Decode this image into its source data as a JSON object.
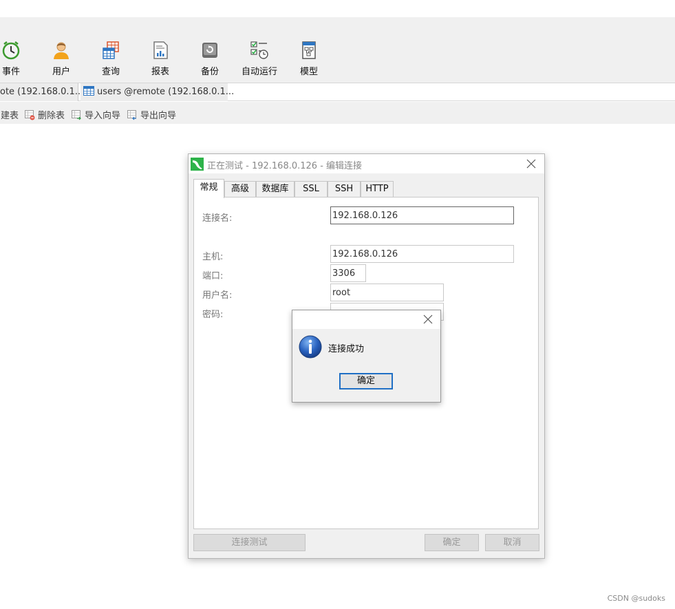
{
  "toolbar": {
    "items": [
      {
        "label": "事件",
        "icon": "clock-icon"
      },
      {
        "label": "用户",
        "icon": "user-icon"
      },
      {
        "label": "查询",
        "icon": "query-table-icon"
      },
      {
        "label": "报表",
        "icon": "report-icon"
      },
      {
        "label": "备份",
        "icon": "backup-icon"
      },
      {
        "label": "自动运行",
        "icon": "schedule-icon"
      },
      {
        "label": "模型",
        "icon": "model-icon"
      }
    ]
  },
  "tabs": {
    "items": [
      {
        "label": "ote (192.168.0.1..."
      },
      {
        "label": "users @remote (192.168.0.1..."
      }
    ]
  },
  "subtoolbar": {
    "items": [
      {
        "label": "建表"
      },
      {
        "label": "删除表"
      },
      {
        "label": "导入向导"
      },
      {
        "label": "导出向导"
      }
    ]
  },
  "connection_dialog": {
    "title": "正在测试 - 192.168.0.126 - 编辑连接",
    "tabs": [
      "常规",
      "高级",
      "数据库",
      "SSL",
      "SSH",
      "HTTP"
    ],
    "active_tab": "常规",
    "fields": {
      "connection_name": {
        "label": "连接名:",
        "value": "192.168.0.126"
      },
      "host": {
        "label": "主机:",
        "value": "192.168.0.126"
      },
      "port": {
        "label": "端口:",
        "value": "3306"
      },
      "username": {
        "label": "用户名:",
        "value": "root"
      },
      "password": {
        "label": "密码:",
        "value": ""
      }
    },
    "buttons": {
      "test_connection": "连接测试",
      "ok": "确定",
      "cancel": "取消"
    }
  },
  "message_box": {
    "message": "连接成功",
    "ok_label": "确定",
    "icon": "info-icon"
  },
  "watermark": "CSDN @sudoks",
  "colors": {
    "accent_blue": "#1f6fc5",
    "logo_green": "#2eb34a",
    "toolbar_bg": "#f0f0f0"
  }
}
